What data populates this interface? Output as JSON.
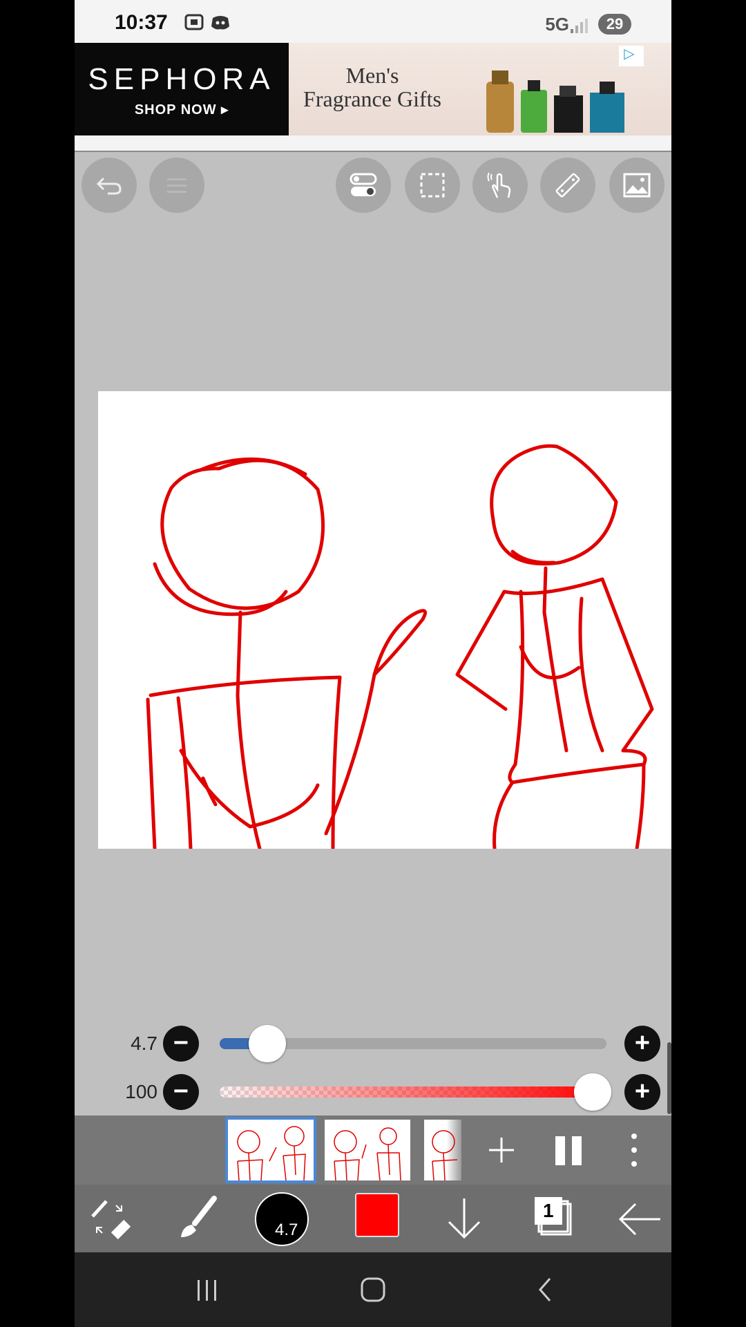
{
  "status_bar": {
    "time": "10:37",
    "network": "5G",
    "battery": "29"
  },
  "ad": {
    "brand": "SEPHORA",
    "cta": "SHOP NOW ▸",
    "headline_line1": "Men's",
    "headline_line2": "Fragrance Gifts",
    "info_icon": "adchoices-icon",
    "menu_icon": "more-vert-icon"
  },
  "top_tools": [
    "undo-icon",
    "menu-icon",
    "toggle-icon",
    "selection-icon",
    "gesture-icon",
    "ruler-icon",
    "image-icon"
  ],
  "brush_size": {
    "label": "4.7",
    "level": 0.07
  },
  "opacity": {
    "label": "100",
    "level": 1.0
  },
  "layers": {
    "add_label": "+",
    "count": "1"
  },
  "brush_indicator": "4.7",
  "colors": {
    "current": "#ff0000",
    "stroke": "#e00000"
  }
}
